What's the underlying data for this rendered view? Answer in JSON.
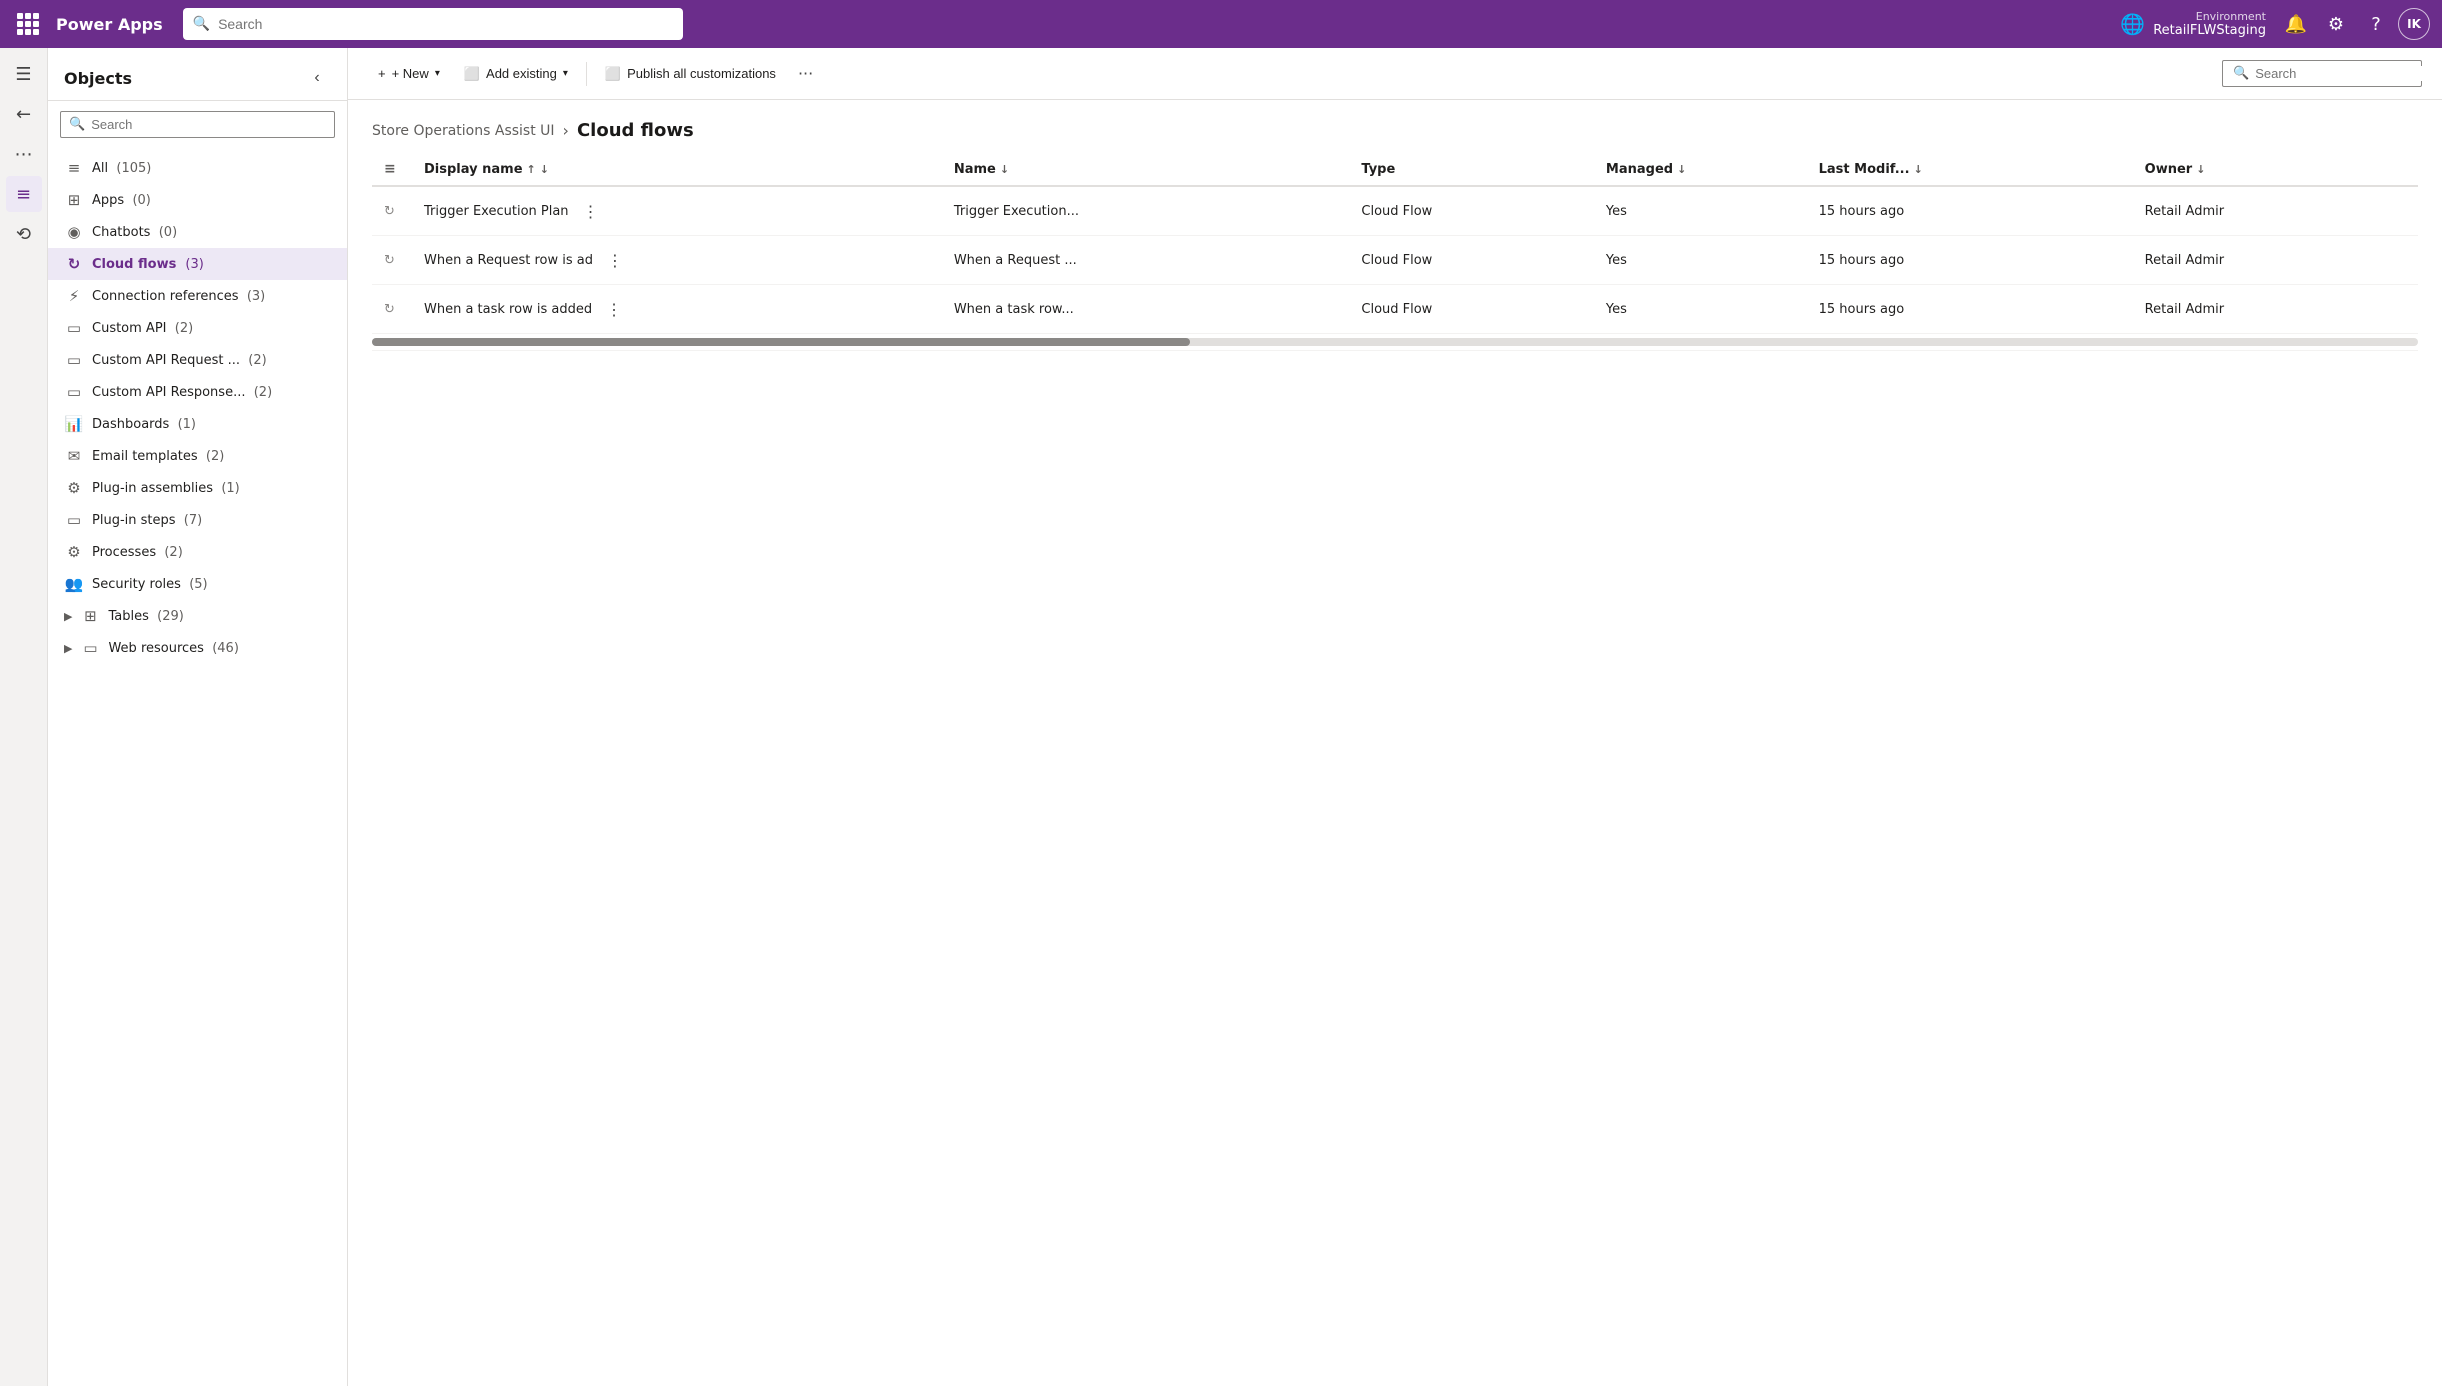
{
  "topbar": {
    "app_title": "Power Apps",
    "search_placeholder": "Search",
    "search_value": "",
    "environment_label": "Environment",
    "environment_name": "RetailFLWStaging",
    "avatar_initials": "IK"
  },
  "sidebar": {
    "title": "Objects",
    "search_placeholder": "Search",
    "items": [
      {
        "id": "all",
        "label": "All",
        "count": "(105)",
        "icon": "≡"
      },
      {
        "id": "apps",
        "label": "Apps",
        "count": "(0)",
        "icon": "⊞"
      },
      {
        "id": "chatbots",
        "label": "Chatbots",
        "count": "(0)",
        "icon": "◉"
      },
      {
        "id": "cloud-flows",
        "label": "Cloud flows",
        "count": "(3)",
        "icon": "↻",
        "active": true
      },
      {
        "id": "connection-refs",
        "label": "Connection references",
        "count": "(3)",
        "icon": "⚡"
      },
      {
        "id": "custom-api",
        "label": "Custom API",
        "count": "(2)",
        "icon": "▭"
      },
      {
        "id": "custom-api-request",
        "label": "Custom API Request ...",
        "count": "(2)",
        "icon": "▭"
      },
      {
        "id": "custom-api-response",
        "label": "Custom API Response...",
        "count": "(2)",
        "icon": "▭"
      },
      {
        "id": "dashboards",
        "label": "Dashboards",
        "count": "(1)",
        "icon": "📊"
      },
      {
        "id": "email-templates",
        "label": "Email templates",
        "count": "(2)",
        "icon": "✉"
      },
      {
        "id": "plugin-assemblies",
        "label": "Plug-in assemblies",
        "count": "(1)",
        "icon": "⚙"
      },
      {
        "id": "plugin-steps",
        "label": "Plug-in steps",
        "count": "(7)",
        "icon": "▭"
      },
      {
        "id": "processes",
        "label": "Processes",
        "count": "(2)",
        "icon": "⚙"
      },
      {
        "id": "security-roles",
        "label": "Security roles",
        "count": "(5)",
        "icon": "👥"
      },
      {
        "id": "tables",
        "label": "Tables",
        "count": "(29)",
        "icon": "⊞",
        "expandable": true
      },
      {
        "id": "web-resources",
        "label": "Web resources",
        "count": "(46)",
        "icon": "▭",
        "expandable": true
      }
    ]
  },
  "toolbar": {
    "new_label": "+ New",
    "add_existing_label": "Add existing",
    "publish_label": "Publish all customizations",
    "search_placeholder": "Search",
    "search_value": ""
  },
  "breadcrumb": {
    "parent": "Store Operations Assist UI",
    "separator": "›",
    "current": "Cloud flows"
  },
  "table": {
    "columns": [
      {
        "id": "display-name",
        "label": "Display name",
        "sortable": true,
        "sort_dir": "asc"
      },
      {
        "id": "name",
        "label": "Name",
        "sortable": true
      },
      {
        "id": "type",
        "label": "Type",
        "sortable": false
      },
      {
        "id": "managed",
        "label": "Managed",
        "sortable": true
      },
      {
        "id": "last-modified",
        "label": "Last Modif...",
        "sortable": true
      },
      {
        "id": "owner",
        "label": "Owner",
        "sortable": true
      }
    ],
    "rows": [
      {
        "display_name": "Trigger Execution Plan",
        "name": "Trigger Execution...",
        "type": "Cloud Flow",
        "managed": "Yes",
        "last_modified": "15 hours ago",
        "owner": "Retail Admir"
      },
      {
        "display_name": "When a Request row is ad",
        "name": "When a Request ...",
        "type": "Cloud Flow",
        "managed": "Yes",
        "last_modified": "15 hours ago",
        "owner": "Retail Admir"
      },
      {
        "display_name": "When a task row is added",
        "name": "When a task row...",
        "type": "Cloud Flow",
        "managed": "Yes",
        "last_modified": "15 hours ago",
        "owner": "Retail Admir"
      }
    ]
  }
}
